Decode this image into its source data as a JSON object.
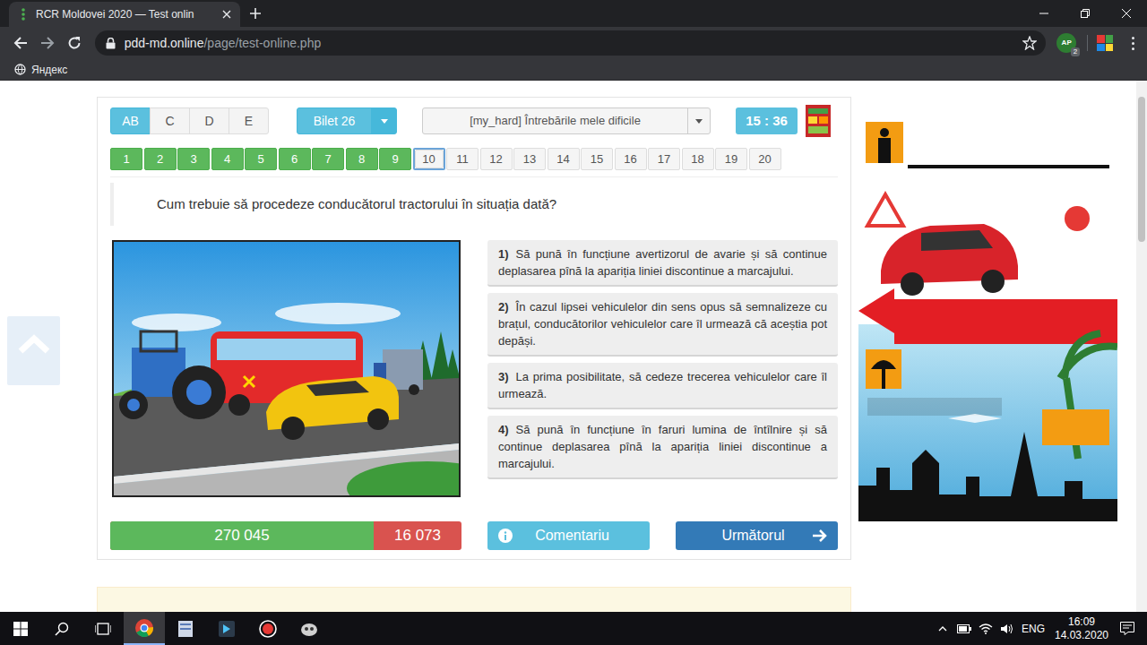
{
  "browser": {
    "tab_title": "RCR Moldovei 2020 — Test onlin",
    "url_host": "pdd-md.online",
    "url_path": "/page/test-online.php",
    "bookmark": "Яндекс",
    "extension": {
      "label": "AP",
      "badge": "2"
    }
  },
  "categories": [
    {
      "label": "AB",
      "selected": true
    },
    {
      "label": "C",
      "selected": false
    },
    {
      "label": "D",
      "selected": false
    },
    {
      "label": "E",
      "selected": false
    }
  ],
  "ticket": "Bilet 26",
  "question_set": "[my_hard] Întrebările mele dificile",
  "timer": "15 : 36",
  "questions": [
    {
      "label": "1",
      "answered": true,
      "selected": false
    },
    {
      "label": "2",
      "answered": true,
      "selected": false
    },
    {
      "label": "3",
      "answered": true,
      "selected": false
    },
    {
      "label": "4",
      "answered": true,
      "selected": false
    },
    {
      "label": "5",
      "answered": true,
      "selected": false
    },
    {
      "label": "6",
      "answered": true,
      "selected": false
    },
    {
      "label": "7",
      "answered": true,
      "selected": false
    },
    {
      "label": "8",
      "answered": true,
      "selected": false
    },
    {
      "label": "9",
      "answered": true,
      "selected": false
    },
    {
      "label": "10",
      "answered": false,
      "selected": true
    },
    {
      "label": "11",
      "answered": false,
      "selected": false
    },
    {
      "label": "12",
      "answered": false,
      "selected": false
    },
    {
      "label": "13",
      "answered": false,
      "selected": false
    },
    {
      "label": "14",
      "answered": false,
      "selected": false
    },
    {
      "label": "15",
      "answered": false,
      "selected": false
    },
    {
      "label": "16",
      "answered": false,
      "selected": false
    },
    {
      "label": "17",
      "answered": false,
      "selected": false
    },
    {
      "label": "18",
      "answered": false,
      "selected": false
    },
    {
      "label": "19",
      "answered": false,
      "selected": false
    },
    {
      "label": "20",
      "answered": false,
      "selected": false
    }
  ],
  "question": "Cum trebuie să procedeze conducătorul tractorului în situația dată?",
  "answers": [
    {
      "number": "1)",
      "text": "Să pună în funcțiune avertizorul de avarie și să continue deplasarea pînă la apariția liniei discontinue a marcajului."
    },
    {
      "number": "2)",
      "text": "În cazul lipsei vehiculelor din sens opus să semnalizeze cu brațul, conducătorilor vehiculelor care îl urmează că aceștia pot depăși."
    },
    {
      "number": "3)",
      "text": "La prima posibilitate, să cedeze trecerea vehiculelor care îl urmează."
    },
    {
      "number": "4)",
      "text": "Să pună în funcțiune în faruri lumina de întîlnire și să continue deplasarea pînă la apariția liniei discontinue a marcajului."
    }
  ],
  "stats": {
    "correct": "270 045",
    "wrong": "16 073",
    "level": 0.75
  },
  "buttons": {
    "comment": "Comentariu",
    "next": "Următorul"
  },
  "taskbar": {
    "language": "ENG",
    "time": "16:09",
    "date": "14.03.2020"
  }
}
